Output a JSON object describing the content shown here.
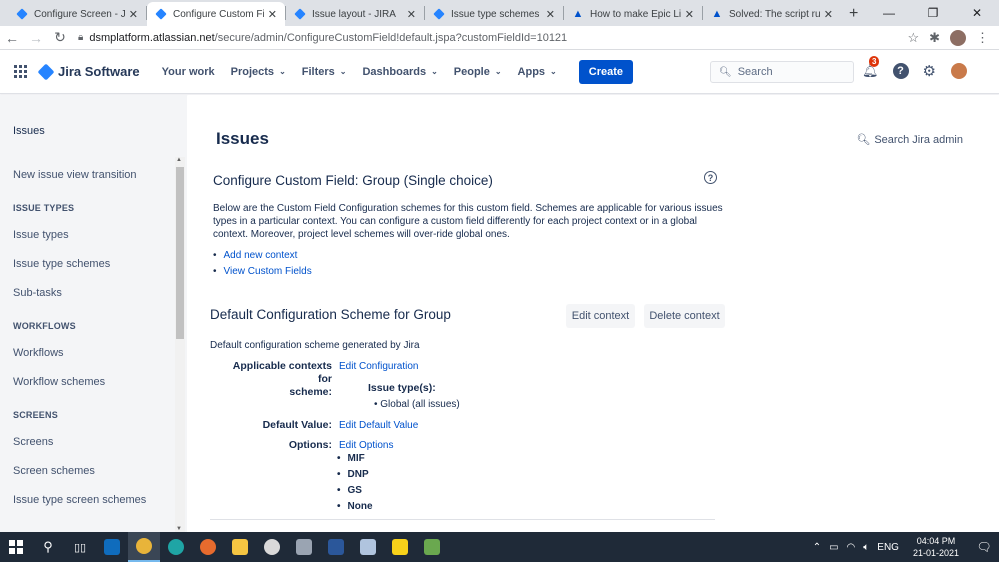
{
  "browser": {
    "tabs": [
      {
        "title": "Configure Screen - JIRA",
        "icon": "jira-icon",
        "active": false
      },
      {
        "title": "Configure Custom Field:",
        "icon": "jira-icon",
        "active": true
      },
      {
        "title": "Issue layout - JIRA",
        "icon": "jira-icon",
        "active": false
      },
      {
        "title": "Issue type schemes - JIR",
        "icon": "jira-icon",
        "active": false
      },
      {
        "title": "How to make Epic Link",
        "icon": "atlassian-icon",
        "active": false
      },
      {
        "title": "Solved: The script runn",
        "icon": "atlassian-icon",
        "active": false
      }
    ],
    "new_tab": "+",
    "url_host": "dsmplatform.atlassian.net",
    "url_path": "/secure/admin/ConfigureCustomField!default.jspa?customFieldId=10121"
  },
  "jira_nav": {
    "product": "Jira Software",
    "items": [
      {
        "label": "Your work",
        "dropdown": false
      },
      {
        "label": "Projects",
        "dropdown": true
      },
      {
        "label": "Filters",
        "dropdown": true
      },
      {
        "label": "Dashboards",
        "dropdown": true
      },
      {
        "label": "People",
        "dropdown": true
      },
      {
        "label": "Apps",
        "dropdown": true
      }
    ],
    "create_label": "Create",
    "search_placeholder": "Search",
    "notification_count": "3",
    "help_label": "?"
  },
  "sidebar": {
    "heading": "Issues",
    "entries": [
      {
        "kind": "item",
        "label": "New issue view transition"
      },
      {
        "kind": "section",
        "label": "ISSUE TYPES"
      },
      {
        "kind": "item",
        "label": "Issue types"
      },
      {
        "kind": "item",
        "label": "Issue type schemes"
      },
      {
        "kind": "item",
        "label": "Sub-tasks"
      },
      {
        "kind": "section",
        "label": "WORKFLOWS"
      },
      {
        "kind": "item",
        "label": "Workflows"
      },
      {
        "kind": "item",
        "label": "Workflow schemes"
      },
      {
        "kind": "section",
        "label": "SCREENS"
      },
      {
        "kind": "item",
        "label": "Screens"
      },
      {
        "kind": "item",
        "label": "Screen schemes"
      },
      {
        "kind": "item",
        "label": "Issue type screen schemes"
      }
    ]
  },
  "main": {
    "page_title": "Issues",
    "admin_search": "Search Jira admin",
    "cf_title": "Configure Custom Field: Group (Single choice)",
    "help_glyph": "?",
    "description": "Below are the Custom Field Configuration schemes for this custom field. Schemes are applicable for various issues types in a particular context. You can configure a custom field differently for each project context or in a global context. Moreover, project level schemes will over-ride global ones.",
    "links": [
      "Add new context",
      "View Custom Fields"
    ],
    "scheme": {
      "title": "Default Configuration Scheme for Group",
      "edit_context": "Edit context",
      "delete_context": "Delete context",
      "description": "Default configuration scheme generated by Jira",
      "applicable_label_1": "Applicable contexts for",
      "applicable_label_2": "scheme:",
      "edit_configuration": "Edit Configuration",
      "issue_types_label": "Issue type(s):",
      "issue_types_value": "Global (all issues)",
      "default_value_label": "Default Value:",
      "edit_default_value": "Edit Default Value",
      "options_label": "Options:",
      "edit_options": "Edit Options",
      "options": [
        "MIF",
        "DNP",
        "GS",
        "None"
      ]
    }
  },
  "taskbar": {
    "lang": "ENG",
    "time": "04:04 PM",
    "date": "21-01-2021"
  },
  "colors": {
    "jira_blue": "#0052cc",
    "link": "#0052cc",
    "badge": "#de350b"
  }
}
